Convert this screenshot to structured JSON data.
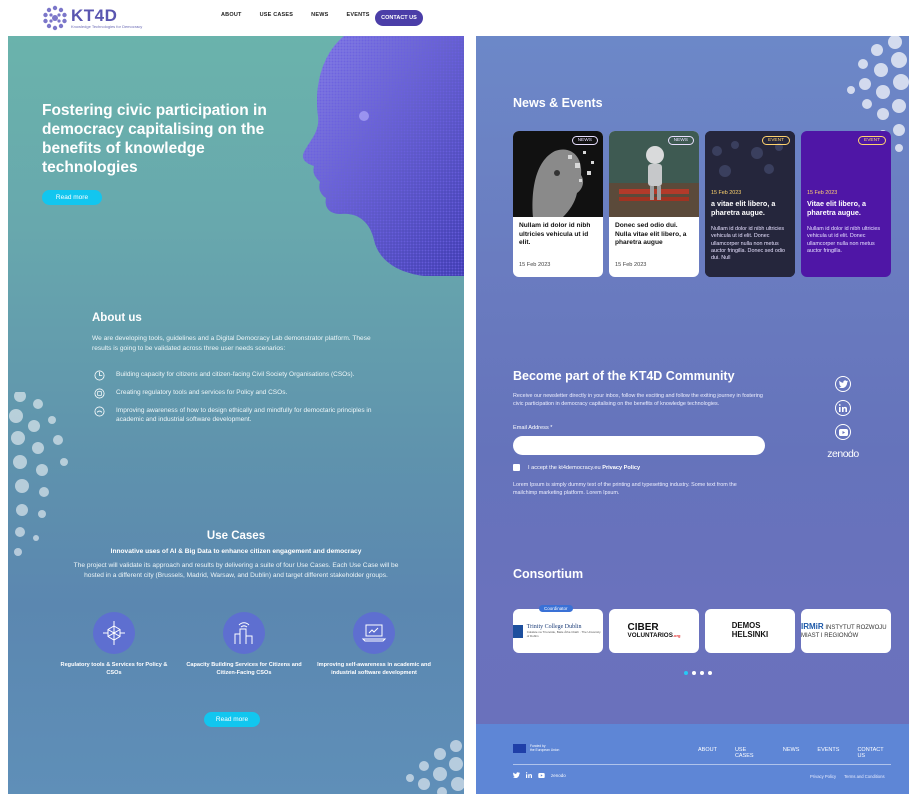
{
  "nav": {
    "logo_word": "KT4D",
    "logo_sub": "Knowledge Technologies for Democracy",
    "links": [
      "ABOUT",
      "USE CASES",
      "NEWS",
      "EVENTS"
    ],
    "contact": "CONTACT US"
  },
  "hero": {
    "title": "Fostering civic participation in democracy capitalising on the benefits of knowledge technologies",
    "read_more": "Read more"
  },
  "about": {
    "heading": "About us",
    "intro": "We are developing tools, guidelines and a Digital Democracy Lab demonstrator platform. These results is going to be validated across three user needs scenarios:",
    "items": [
      "Building capacity for citizens and citizen-facing Civil Society Organisations (CSOs).",
      "Creating regulatory tools and services for Policy and CSOs.",
      "Improving awareness of how to design ethically and mindfully for democtaric principles in academic and industrial software development."
    ]
  },
  "use_cases": {
    "heading": "Use Cases",
    "subheading": "Innovative uses of AI & Big Data to enhance citizen engagement and democracy",
    "text": "The project will validate its approach and results by delivering a suite of four Use Cases. Each Use Case will be hosted in a different city (Brussels, Madrid, Warsaw, and Dublin) and target different stakeholder groups.",
    "cards": [
      "Regulatory tools & Services for Policy & CSOs",
      "Capacity Building Services for Citizens and Citizen-Facing CSOs",
      "Improving self-awareness in academic and industrial software development"
    ],
    "read_more": "Read more"
  },
  "news": {
    "heading": "News & Events",
    "cards": [
      {
        "badge": "NEWS",
        "title": "Nullam id dolor id nibh ultricies vehicula ut id elit.",
        "date": "15 Feb 2023"
      },
      {
        "badge": "NEWS",
        "title": "Donec sed odio dui. Nulla vitae elit libero, a pharetra augue",
        "date": "15 Feb 2023"
      },
      {
        "badge": "EVENT",
        "date": "15 Feb 2023",
        "title": "a vitae elit libero, a pharetra augue.",
        "text": "Nullam id dolor id nibh ultricies vehicula ut id elit. Donec ullamcorper nulla non metus auctor fringilla. Donec sed odio dui. Null"
      },
      {
        "badge": "EVENT",
        "date": "15 Feb 2023",
        "title": "Vitae elit libero, a pharetra augue.",
        "text": "Nullam id dolor id nibh ultricies vehicula ut id elit. Donec ullamcorper nulla non metus auctor fringilla."
      }
    ]
  },
  "community": {
    "heading": "Become part of the KT4D Community",
    "intro": "Receive our newsletter directly in your inbox, follow the exciting and follow the exiting journey in fostering civic participation in democracy capitalising on the benefits of knowledge technologies.",
    "email_label": "Email Address *",
    "email_value": "",
    "checkbox_prefix": "I accept the kt4democracy.eu",
    "checkbox_link": "Privacy Policy",
    "lorem": "Lorem Ipsum is simply dummy text of the printing and typesetting industry. Some text from the mailchimp marketing platform. Lorem Ipsum.",
    "zenodo": "zenodo"
  },
  "consortium": {
    "heading": "Consortium",
    "coordinator": "Coordinator",
    "p1_name": "Trinity College Dublin",
    "p1_sub": "Coláiste na Tríonóide, Baile Átha Cliath · The University of Dublin",
    "p2_a": "CIBER",
    "p2_b": "VOLUNTARIOS",
    "p2_c": ".org",
    "p3_a": "DEMOS",
    "p3_b": "HELSINKI",
    "p4_a": "IRMiR",
    "p4_b": "INSTYTUT ROZWOJU MIAST I REGIONÓW",
    "active_page": 1,
    "pages": 4
  },
  "footer": {
    "eu_line1": "Funded by",
    "eu_line2": "the European Union",
    "links": [
      "ABOUT",
      "USE CASES",
      "NEWS",
      "EVENTS",
      "CONTACT US"
    ],
    "zenodo": "zenodo",
    "privacy": "Privacy Policy",
    "terms": "Terms and Conditions"
  },
  "colors": {
    "accent": "#4b3ea8",
    "cyan": "#12c6ef",
    "event": "#ffd36e"
  }
}
